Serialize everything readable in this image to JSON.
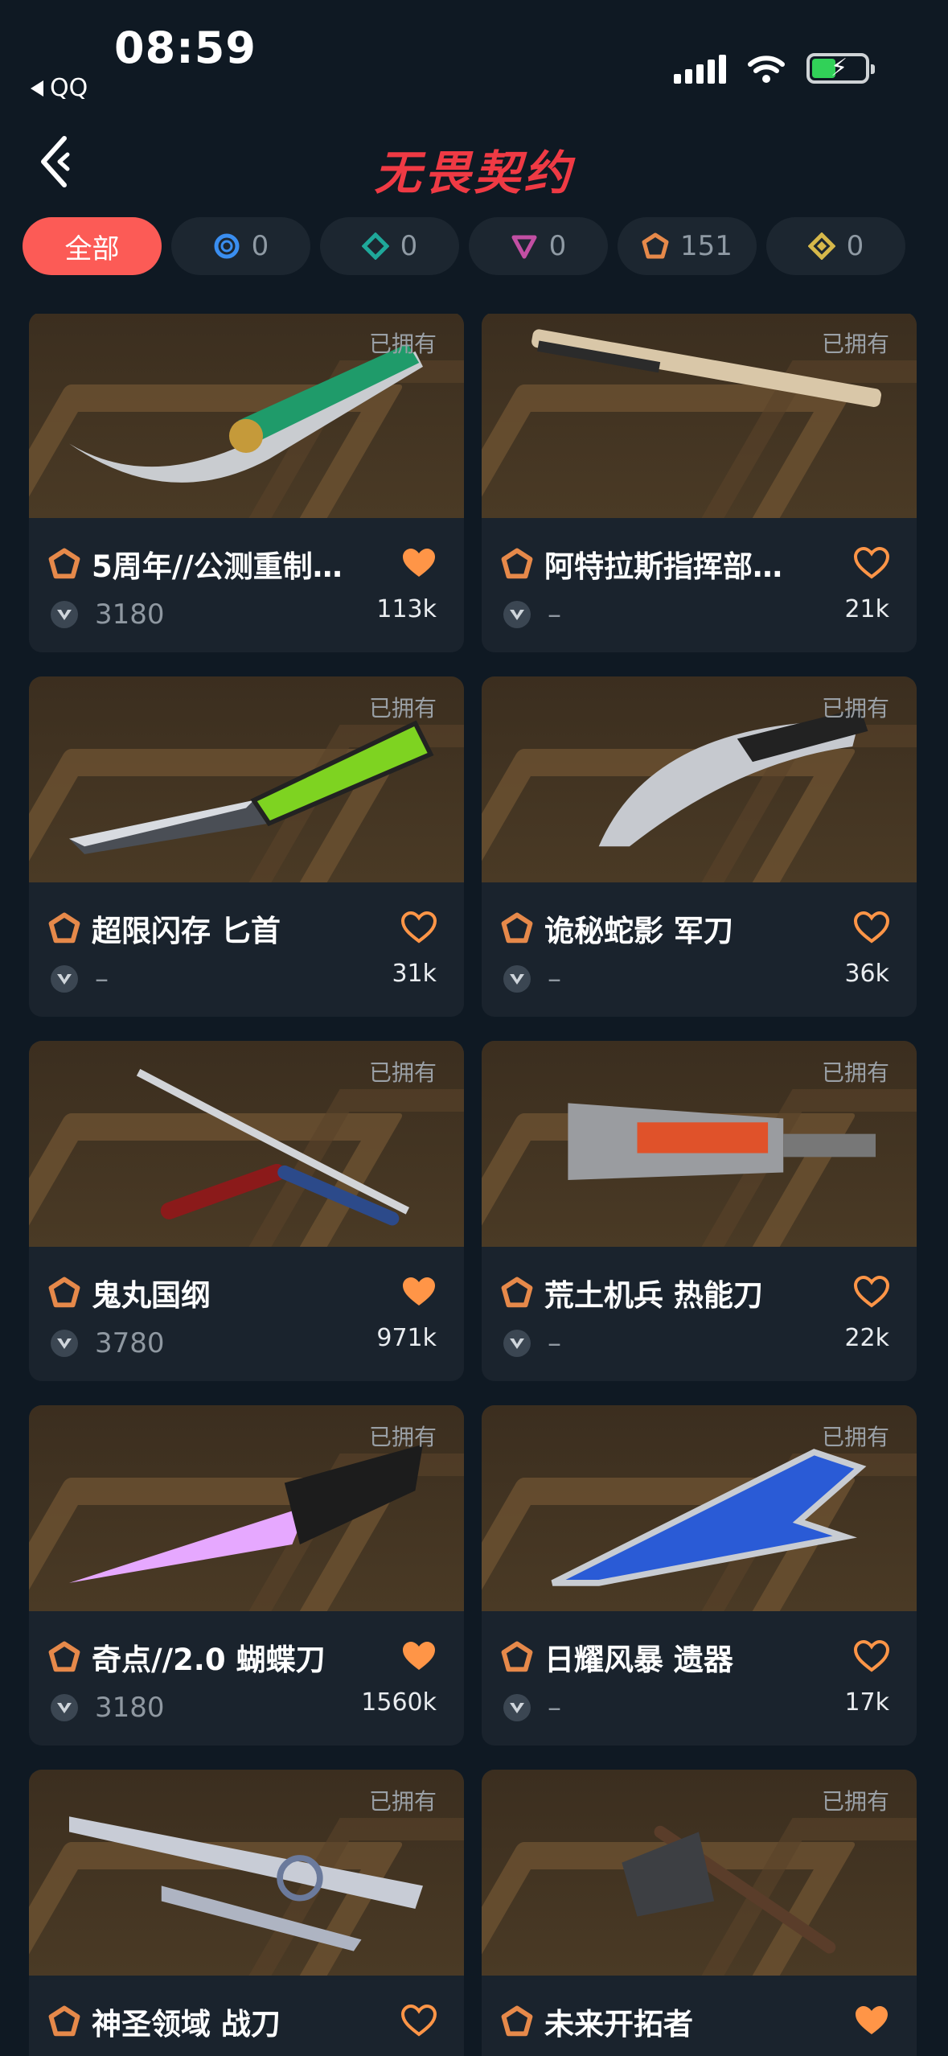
{
  "status_bar": {
    "time": "08:59",
    "back_app": "QQ",
    "icons": [
      "signal-icon",
      "wifi-icon",
      "battery-charging-icon"
    ]
  },
  "header": {
    "title": "无畏契约",
    "back_icon": "chevron-left-icon"
  },
  "filters": [
    {
      "label": "全部",
      "active": true
    },
    {
      "icon": "select-tier-icon",
      "count": "0",
      "color": "#3a8ef0"
    },
    {
      "icon": "deluxe-tier-icon",
      "count": "0",
      "color": "#1fa89a"
    },
    {
      "icon": "premium-tier-icon",
      "count": "0",
      "color": "#c24fa3"
    },
    {
      "icon": "exclusive-tier-icon",
      "count": "151",
      "color": "#e6894a"
    },
    {
      "icon": "ultra-tier-icon",
      "count": "0",
      "color": "#d6b84a"
    }
  ],
  "owned_label": "已拥有",
  "accent_color": "#fc5b56",
  "items": [
    {
      "name": "5周年//公测重制…",
      "price": "3180",
      "likes": "113k",
      "liked": true,
      "owned": true,
      "weapon": "scimitar"
    },
    {
      "name": "阿特拉斯指挥部…",
      "price": "–",
      "likes": "21k",
      "liked": false,
      "owned": true,
      "weapon": "staff"
    },
    {
      "name": "超限闪存 匕首",
      "price": "–",
      "likes": "31k",
      "liked": false,
      "owned": true,
      "weapon": "tanto"
    },
    {
      "name": "诡秘蛇影 军刀",
      "price": "–",
      "likes": "36k",
      "liked": false,
      "owned": true,
      "weapon": "karambit"
    },
    {
      "name": "鬼丸国纲",
      "price": "3780",
      "likes": "971k",
      "liked": true,
      "owned": true,
      "weapon": "katana"
    },
    {
      "name": "荒土机兵 热能刀",
      "price": "–",
      "likes": "22k",
      "liked": false,
      "owned": true,
      "weapon": "cleaver"
    },
    {
      "name": "奇点//2.0 蝴蝶刀",
      "price": "3180",
      "likes": "1560k",
      "liked": true,
      "owned": true,
      "weapon": "crystal"
    },
    {
      "name": "日耀风暴 遗器",
      "price": "–",
      "likes": "17k",
      "liked": false,
      "owned": true,
      "weapon": "blade-blue"
    },
    {
      "name": "神圣领域 战刀",
      "price": "",
      "likes": "",
      "liked": false,
      "owned": true,
      "weapon": "sword-silver"
    },
    {
      "name": "未来开拓者",
      "price": "",
      "likes": "",
      "liked": true,
      "owned": true,
      "weapon": "axe"
    }
  ]
}
